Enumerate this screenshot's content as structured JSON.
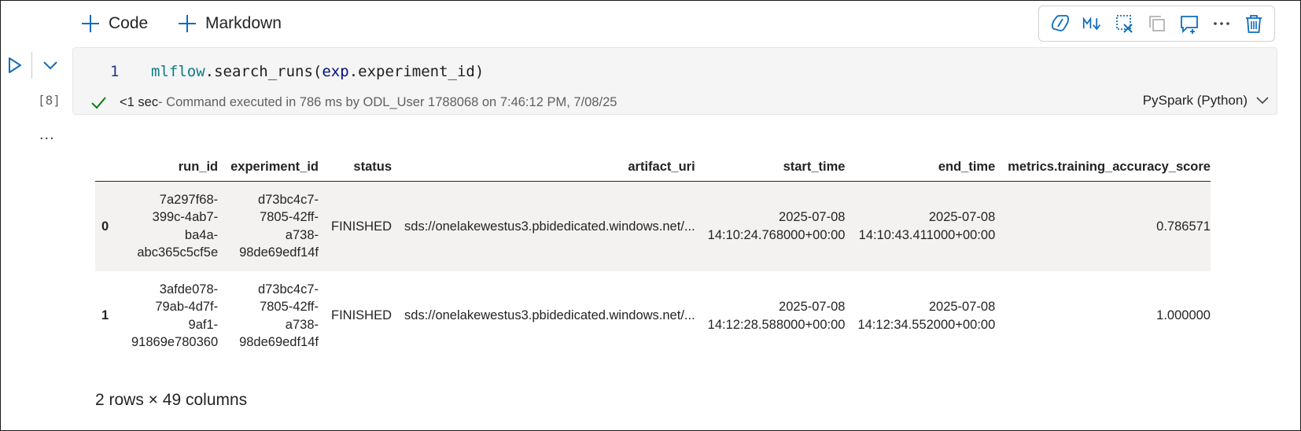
{
  "toolbar": {
    "add_code_label": "Code",
    "add_markdown_label": "Markdown",
    "icons": [
      "copilot-icon",
      "markdown-toggle-icon",
      "clear-output-icon",
      "copy-cell-icon",
      "comment-icon",
      "more-options-icon",
      "delete-icon"
    ]
  },
  "cell": {
    "execution_count": "[8]",
    "line_number": "1",
    "code": {
      "module": "mlflow",
      "method": ".search_runs(",
      "arg_obj": "exp",
      "arg_attr": ".experiment_id)"
    },
    "status": {
      "duration": "<1 sec",
      "detail": " - Command executed in 786 ms by ODL_User 1788068 on 7:46:12 PM, 7/08/25"
    },
    "language": "PySpark (Python)",
    "more_label": "..."
  },
  "output": {
    "columns": [
      "",
      "run_id",
      "experiment_id",
      "status",
      "artifact_uri",
      "start_time",
      "end_time",
      "metrics.training_accuracy_score"
    ],
    "rows": [
      {
        "index": "0",
        "run_id": "7a297f68-\n399c-4ab7-\nba4a-\nabc365c5cf5e",
        "experiment_id": "d73bc4c7-\n7805-42ff-\na738-\n98de69edf14f",
        "status": "FINISHED",
        "artifact_uri": "sds://onelakewestus3.pbidedicated.windows.net/...",
        "start_time": "2025-07-08\n14:10:24.768000+00:00",
        "end_time": "2025-07-08\n14:10:43.411000+00:00",
        "metric": "0.786571"
      },
      {
        "index": "1",
        "run_id": "3afde078-\n79ab-4d7f-\n9af1-\n91869e780360",
        "experiment_id": "d73bc4c7-\n7805-42ff-\na738-\n98de69edf14f",
        "status": "FINISHED",
        "artifact_uri": "sds://onelakewestus3.pbidedicated.windows.net/...",
        "start_time": "2025-07-08\n14:12:28.588000+00:00",
        "end_time": "2025-07-08\n14:12:34.552000+00:00",
        "metric": "1.000000"
      }
    ],
    "shape_note": "2 rows × 49 columns"
  },
  "colors": {
    "accent": "#0f6cbd",
    "success": "#107c10",
    "cell_bg": "#f5f5f5",
    "row_stripe": "#f3f2f1"
  }
}
